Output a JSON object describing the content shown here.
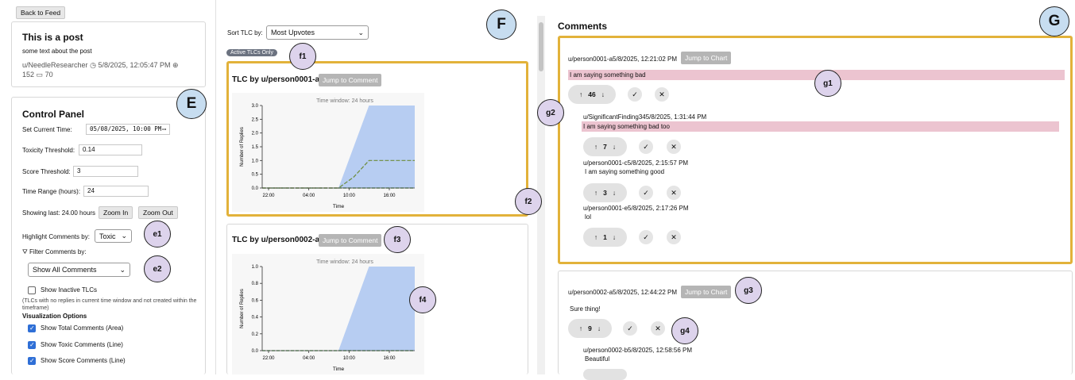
{
  "nav": {
    "back": "Back to Feed"
  },
  "post": {
    "title": "This is a post",
    "body": "some text about the post",
    "author": "u/NeedleResearcher",
    "date": "5/8/2025, 12:05:47 PM",
    "score": "152",
    "comments": "70"
  },
  "control": {
    "title": "Control Panel",
    "current_time_label": "Set Current Time:",
    "current_time_value": "05/08/2025, 10:00 PM",
    "toxicity_label": "Toxicity Threshold:",
    "toxicity_value": "0.14",
    "score_label": "Score Threshold:",
    "score_value": "3",
    "range_label": "Time Range (hours):",
    "range_value": "24",
    "showing": "Showing last: 24.00 hours",
    "zoom_in": "Zoom In",
    "zoom_out": "Zoom Out",
    "highlight_label": "Highlight Comments by:",
    "highlight_value": "Toxic",
    "filter_label": "Filter Comments by:",
    "filter_value": "Show All Comments",
    "inactive_label": "Show Inactive TLCs",
    "inactive_note": "(TLCs with no replies in current time window and not created within the timeframe)",
    "viz_title": "Visualization Options",
    "viz_options": [
      "Show Total Comments (Area)",
      "Show Toxic Comments (Line)",
      "Show Score Comments (Line)"
    ]
  },
  "middle": {
    "sort_label": "Sort TLC by:",
    "sort_value": "Most Upvotes",
    "active_badge": "Active TLCs Only",
    "jump_label": "Jump to Comment",
    "cards": [
      {
        "title": "TLC by u/person0001-a"
      },
      {
        "title": "TLC by u/person0002-a"
      }
    ]
  },
  "chart_data": [
    {
      "type": "area",
      "annotation": "Time window: 24 hours",
      "xlabel": "Time",
      "ylabel": "Number of Replies",
      "x_ticks": [
        "22:00",
        "04:00",
        "10:00",
        "16:00"
      ],
      "y_ticks": [
        "0.0",
        "0.5",
        "1.0",
        "1.5",
        "2.0",
        "2.5",
        "3.0"
      ],
      "ylim": [
        0,
        3
      ],
      "series": [
        {
          "values": [
            0,
            0,
            0,
            0,
            0,
            0,
            1.5,
            3,
            3,
            3,
            3
          ]
        },
        {
          "values": [
            0,
            0,
            0,
            0,
            0,
            0,
            0.4,
            1,
            1,
            1,
            1
          ]
        }
      ]
    },
    {
      "type": "area",
      "annotation": "Time window: 24 hours",
      "xlabel": "Time",
      "ylabel": "Number of Replies",
      "x_ticks": [
        "22:00",
        "04:00",
        "10:00",
        "16:00"
      ],
      "y_ticks": [
        "0.0",
        "0.2",
        "0.4",
        "0.6",
        "0.8",
        "1.0"
      ],
      "ylim": [
        0,
        1
      ],
      "series": [
        {
          "values": [
            0,
            0,
            0,
            0,
            0,
            0,
            0.5,
            1,
            1,
            1,
            1
          ]
        }
      ]
    }
  ],
  "comments": {
    "title": "Comments",
    "jump_chart": "Jump to Chart",
    "thread1": {
      "header": "u/person0001-a5/8/2025, 12:21:02 PM",
      "text": "I am saying something bad",
      "votes": "46",
      "replies": [
        {
          "header": "u/SignificantFinding345/8/2025, 1:31:44 PM",
          "text": "I am saying something bad too",
          "votes": "7"
        },
        {
          "header": "u/person0001-c5/8/2025, 2:15:57 PM",
          "text": "I am saying something good",
          "votes": "3"
        },
        {
          "header": "u/person0001-e5/8/2025, 2:17:26 PM",
          "text": "lol",
          "votes": "1"
        }
      ]
    },
    "thread2": {
      "header": "u/person0002-a5/8/2025, 12:44:22 PM",
      "text": "Sure thing!",
      "votes": "9",
      "reply": {
        "header": "u/person0002-b5/8/2025, 12:58:56 PM",
        "text": "Beautiful"
      }
    }
  },
  "annotations": {
    "E": "E",
    "F": "F",
    "G": "G",
    "e1": "e1",
    "e2": "e2",
    "f1": "f1",
    "f2": "f2",
    "f3": "f3",
    "f4": "f4",
    "g1": "g1",
    "g2": "g2",
    "g3": "g3",
    "g4": "g4"
  },
  "colors": {
    "highlight_border": "#e2b23a",
    "area_fill": "#b7cdf2",
    "toxic_highlight": "#ecc4d0"
  }
}
